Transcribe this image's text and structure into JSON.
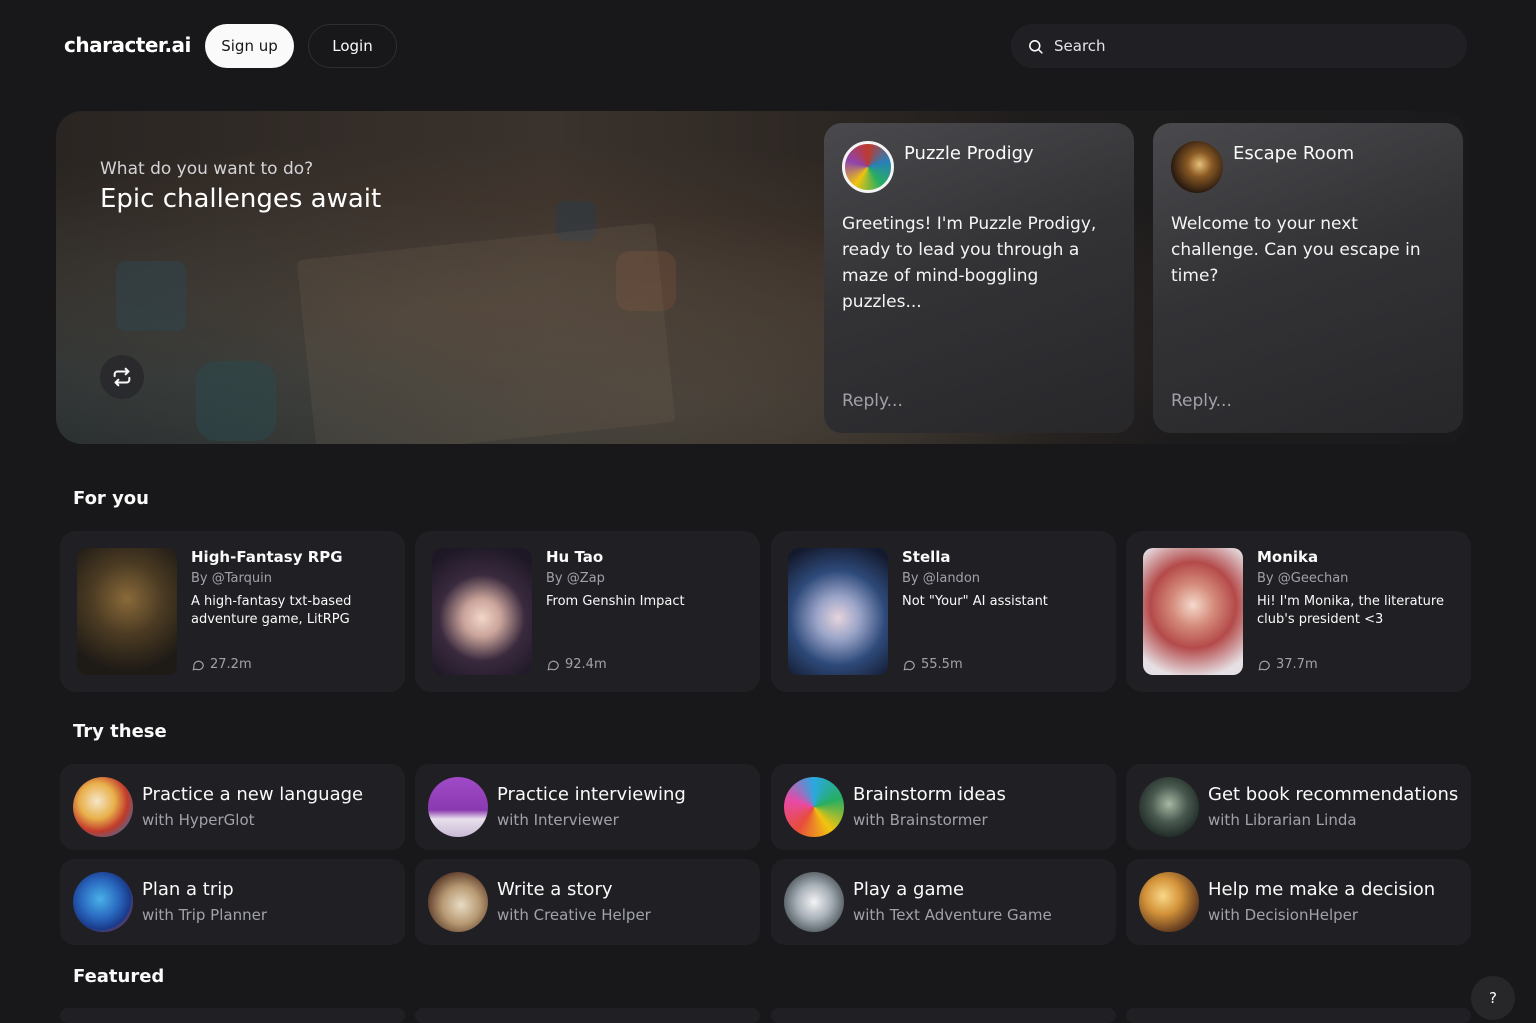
{
  "header": {
    "logo": "character.ai",
    "signup_label": "Sign up",
    "login_label": "Login",
    "search_placeholder": "Search"
  },
  "hero": {
    "subtitle": "What do you want to do?",
    "title": "Epic challenges await",
    "cards": [
      {
        "name": "Puzzle Prodigy",
        "message": "Greetings! I'm Puzzle Prodigy, ready to lead you through a maze of mind-boggling puzzles...",
        "reply_placeholder": "Reply..."
      },
      {
        "name": "Escape Room",
        "message": "Welcome to your next challenge. Can you escape in time?",
        "reply_placeholder": "Reply..."
      }
    ]
  },
  "sections": {
    "for_you": "For you",
    "try_these": "Try these",
    "featured": "Featured"
  },
  "for_you": [
    {
      "name": "High-Fantasy RPG",
      "by": "By @Tarquin",
      "desc": "A high-fantasy txt-based adventure game, LitRPG",
      "count": "27.2m"
    },
    {
      "name": "Hu Tao",
      "by": "By @Zap",
      "desc": "From Genshin Impact",
      "count": "92.4m"
    },
    {
      "name": "Stella",
      "by": "By @landon",
      "desc": "Not \"Your\" AI assistant",
      "count": "55.5m"
    },
    {
      "name": "Monika",
      "by": "By @Geechan",
      "desc": "Hi! I'm Monika, the literature club's president <3",
      "count": "37.7m"
    }
  ],
  "try_these": [
    {
      "title": "Practice a new language",
      "sub": "with HyperGlot"
    },
    {
      "title": "Practice interviewing",
      "sub": "with Interviewer"
    },
    {
      "title": "Brainstorm ideas",
      "sub": "with Brainstormer"
    },
    {
      "title": "Get book recommendations",
      "sub": "with Librarian Linda"
    },
    {
      "title": "Plan a trip",
      "sub": "with Trip Planner"
    },
    {
      "title": "Write a story",
      "sub": "with Creative Helper"
    },
    {
      "title": "Play a game",
      "sub": "with Text Adventure Game"
    },
    {
      "title": "Help me make a decision",
      "sub": "with DecisionHelper"
    }
  ],
  "help_label": "?",
  "icons": {
    "search": "search-icon",
    "refresh": "refresh-icon",
    "chat": "chat-bubble-icon"
  }
}
